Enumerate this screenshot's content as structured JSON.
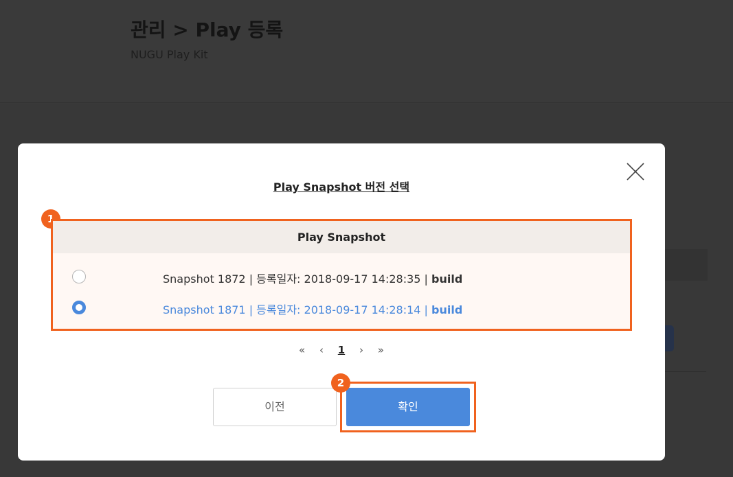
{
  "page": {
    "title": "관리 > Play 등록",
    "subtitle": "NUGU Play Kit"
  },
  "modal": {
    "title": "Play Snapshot 버전 선택",
    "table_header": "Play Snapshot",
    "rows": [
      {
        "text": "Snapshot 1872 | 등록일자: 2018-09-17 14:28:35 | ",
        "tag": "build",
        "selected": false
      },
      {
        "text": "Snapshot 1871 | 등록일자: 2018-09-17 14:28:14 | ",
        "tag": "build",
        "selected": true
      }
    ],
    "pagination": {
      "first": "«",
      "prev": "‹",
      "current": "1",
      "next": "›",
      "last": "»"
    },
    "buttons": {
      "prev_label": "이전",
      "confirm_label": "확인"
    },
    "annotations": [
      "1",
      "2"
    ]
  },
  "colors": {
    "accent": "#4a89dc",
    "highlight": "#f0621e",
    "overlay": "#3a3a3a"
  }
}
